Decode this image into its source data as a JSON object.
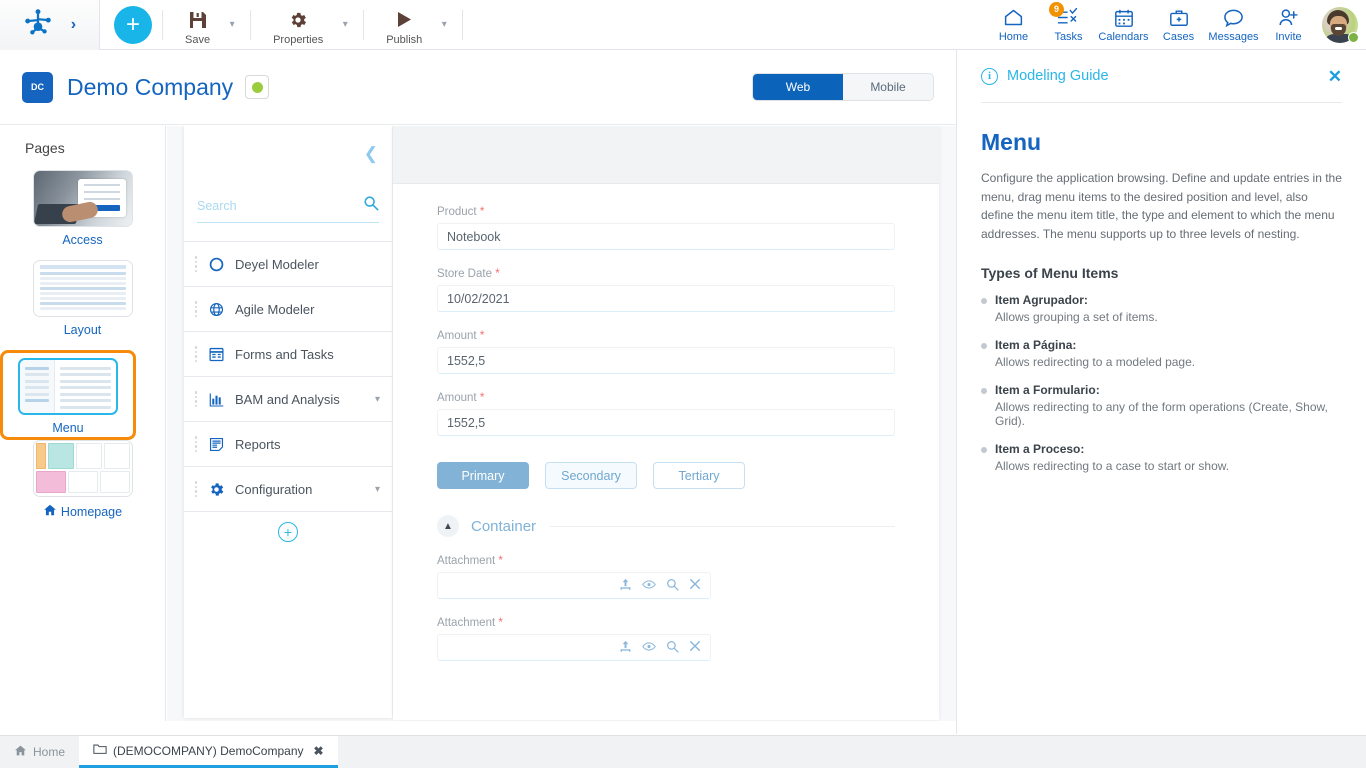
{
  "topbar": {
    "logo_icon": "deyel-node-logo-icon",
    "expand_icon": "chevron-right-icon",
    "add_label": "+",
    "actions": [
      {
        "label": "Save",
        "icon": "save-floppy-icon"
      },
      {
        "label": "Properties",
        "icon": "gear-icon"
      },
      {
        "label": "Publish",
        "icon": "play-triangle-icon"
      }
    ],
    "nav": [
      {
        "label": "Home",
        "icon": "home-icon",
        "badge": ""
      },
      {
        "label": "Tasks",
        "icon": "tasks-checklist-icon",
        "badge": "9"
      },
      {
        "label": "Calendars",
        "icon": "calendar-icon",
        "badge": ""
      },
      {
        "label": "Cases",
        "icon": "briefcase-icon",
        "badge": ""
      },
      {
        "label": "Messages",
        "icon": "speech-bubble-icon",
        "badge": ""
      },
      {
        "label": "Invite",
        "icon": "person-add-icon",
        "badge": ""
      }
    ],
    "avatar_name": "user-avatar",
    "presence": "online"
  },
  "company": {
    "initials": "DC",
    "name": "Demo Company",
    "status_color": "#9ccc3c",
    "view_web": "Web",
    "view_mobile": "Mobile",
    "active_view": "Web"
  },
  "pages": {
    "title": "Pages",
    "items": [
      {
        "label": "Access",
        "selected": false,
        "home": false
      },
      {
        "label": "Layout",
        "selected": false,
        "home": false
      },
      {
        "label": "Menu",
        "selected": true,
        "home": false
      },
      {
        "label": "Homepage",
        "selected": false,
        "home": true
      }
    ]
  },
  "menu_builder": {
    "collapse_icon": "chevron-left-icon",
    "search_placeholder": "Search",
    "search_value": "",
    "search_icon": "search-icon",
    "add_item_label": "+",
    "items": [
      {
        "label": "Deyel Modeler",
        "icon": "circle-outline-icon",
        "expandable": false
      },
      {
        "label": "Agile Modeler",
        "icon": "globe-sketch-icon",
        "expandable": false
      },
      {
        "label": "Forms and Tasks",
        "icon": "form-window-icon",
        "expandable": false
      },
      {
        "label": "BAM and Analysis",
        "icon": "bar-chart-icon",
        "expandable": true
      },
      {
        "label": "Reports",
        "icon": "report-document-icon",
        "expandable": false
      },
      {
        "label": "Configuration",
        "icon": "gear-icon",
        "expandable": true
      }
    ]
  },
  "form_preview": {
    "fields": [
      {
        "label": "Product",
        "required": true,
        "value": "Notebook"
      },
      {
        "label": "Store Date",
        "required": true,
        "value": "10/02/2021"
      },
      {
        "label": "Amount",
        "required": true,
        "value": "1552,5"
      },
      {
        "label": "Amount",
        "required": true,
        "value": "1552,5"
      }
    ],
    "buttons": [
      {
        "label": "Primary",
        "style": "primary"
      },
      {
        "label": "Secondary",
        "style": "secondary"
      },
      {
        "label": "Tertiary",
        "style": "tertiary"
      }
    ],
    "container": {
      "title": "Container",
      "collapse_icon": "chevron-up-icon",
      "attachments": [
        {
          "label": "Attachment",
          "required": true,
          "value": ""
        },
        {
          "label": "Attachment",
          "required": true,
          "value": ""
        }
      ],
      "attachment_icons": [
        "upload-icon",
        "eye-icon",
        "search-icon",
        "clear-x-icon"
      ]
    }
  },
  "guide": {
    "info_icon": "info-circle-icon",
    "panel_title": "Modeling Guide",
    "close_icon": "close-icon",
    "heading": "Menu",
    "paragraph": "Configure the application browsing. Define and update entries in the menu, drag menu items to the desired position and level, also define the menu item title, the type and element to which the menu addresses. The menu supports up to three levels of nesting.",
    "subheading": "Types of Menu Items",
    "items": [
      {
        "term": "Item Agrupador:",
        "desc": "Allows grouping a set of items."
      },
      {
        "term": "Item a Página:",
        "desc": "Allows redirecting to a modeled page."
      },
      {
        "term": "Item a Formulario:",
        "desc": "Allows redirecting to any of the form operations (Create, Show, Grid)."
      },
      {
        "term": "Item a Proceso:",
        "desc": "Allows redirecting to a case to start or show."
      }
    ]
  },
  "taskbar": {
    "home_label": "Home",
    "home_icon": "home-icon",
    "tabs": [
      {
        "label": "(DEMOCOMPANY) DemoCompany",
        "icon": "folder-icon",
        "close": "✖",
        "active": true
      }
    ]
  },
  "colors": {
    "brand_blue": "#1565c0",
    "cyan": "#29b6e8",
    "orange_selection": "#f58a0b",
    "badge_orange": "#f39200",
    "green_status": "#9ccc3c"
  }
}
